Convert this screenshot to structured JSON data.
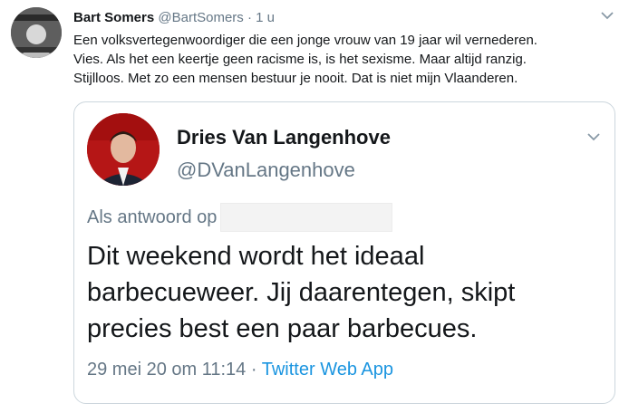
{
  "tweet": {
    "author_name": "Bart Somers",
    "author_handle": "@BartSomers",
    "separator": "·",
    "time": "1 u",
    "avatar_icon": "profile-photo-icon",
    "lines": [
      "Een volksvertegenwoordiger die een jonge vrouw van 19 jaar wil vernederen.",
      "Vies. Als het een keertje geen racisme is, is het sexisme. Maar altijd ranzig.",
      "Stijlloos. Met zo een mensen bestuur je nooit. Dat is niet mijn Vlaanderen."
    ]
  },
  "quoted": {
    "author_name": "Dries Van Langenhove",
    "author_handle": "@DVanLangenhove",
    "reply_prefix": "Als antwoord op",
    "lines": [
      "Dit weekend wordt het ideaal",
      "barbecueweer. Jij daarentegen, skipt",
      "precies best een paar barbecues."
    ],
    "timestamp": "29 mei 20 om 11:14",
    "meta_separator": "·",
    "source": "Twitter Web App"
  },
  "colors": {
    "text": "#14171a",
    "secondary": "#657786",
    "link": "#1b95e0",
    "border": "#ccd6dd"
  }
}
